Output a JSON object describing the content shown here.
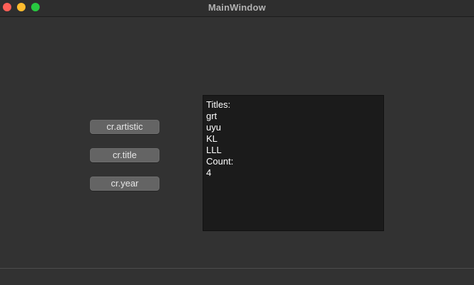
{
  "window": {
    "title": "MainWindow"
  },
  "buttons": {
    "artistic": "cr.artistic",
    "title": "cr.title",
    "year": "cr.year"
  },
  "output": {
    "lines": [
      "Titles:",
      "grt",
      "uyu",
      "KL",
      "LLL",
      "Count:",
      "4"
    ]
  },
  "colors": {
    "close": "#ff5f57",
    "minimize": "#febc2e",
    "zoom": "#28c840"
  }
}
